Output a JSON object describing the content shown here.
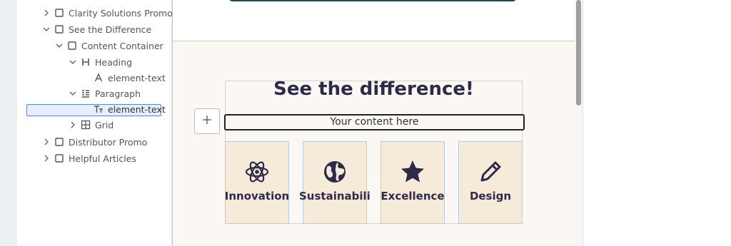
{
  "tree": {
    "items": [
      {
        "label": "Clarity Solutions Promo",
        "chevron": "right",
        "icon": "square-icon"
      },
      {
        "label": "See the Difference",
        "chevron": "down",
        "icon": "square-icon"
      },
      {
        "label": "Content Container",
        "chevron": "down",
        "icon": "square-icon"
      },
      {
        "label": "Heading",
        "chevron": "down",
        "icon": "heading-icon"
      },
      {
        "label": "element-text",
        "chevron": "",
        "icon": "text-a-icon"
      },
      {
        "label": "Paragraph",
        "chevron": "down",
        "icon": "paragraph-icon"
      },
      {
        "label": "element-text",
        "chevron": "",
        "icon": "text-tt-icon"
      },
      {
        "label": "Grid",
        "chevron": "right",
        "icon": "grid-icon"
      },
      {
        "label": "Distributor Promo",
        "chevron": "right",
        "icon": "square-icon"
      },
      {
        "label": "Helpful Articles",
        "chevron": "right",
        "icon": "square-icon"
      }
    ],
    "selected_index": 6
  },
  "canvas": {
    "heading": "See the difference!",
    "content_placeholder": "Your content here",
    "add_button_icon": "plus-icon",
    "cards": [
      {
        "label": "Innovation",
        "icon": "atom-icon"
      },
      {
        "label": "Sustainability",
        "icon": "globe-icon"
      },
      {
        "label": "Excellence",
        "icon": "star-icon"
      },
      {
        "label": "Design",
        "icon": "pencil-icon"
      }
    ]
  },
  "colors": {
    "accent": "#5a8ad6",
    "heading": "#2e2b4a",
    "card_bg": "#f6ead9",
    "canvas_bg": "#fbf8f3",
    "top_bar": "#1d4a55"
  }
}
